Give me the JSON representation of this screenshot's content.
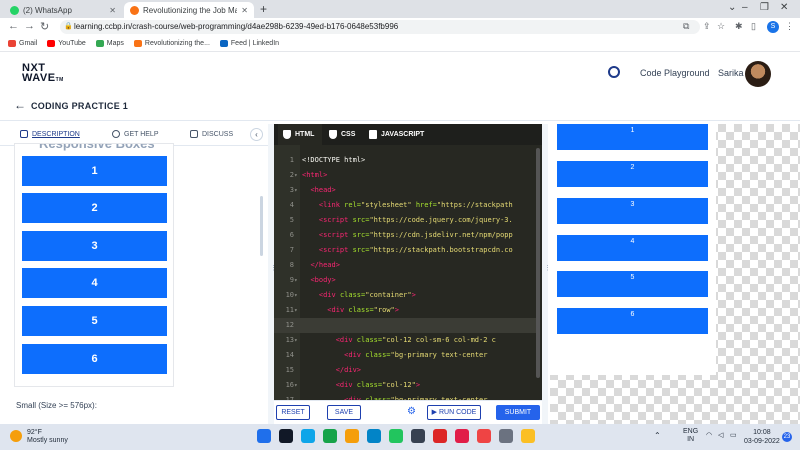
{
  "browser": {
    "tabs": [
      {
        "title": "(2) WhatsApp",
        "favicon_color": "#25d366"
      },
      {
        "title": "Revolutionizing the Job Market |",
        "favicon_color": "#f97316"
      }
    ],
    "url": "learning.ccbp.in/crash-course/web-programming/d4ae298b-6239-49ed-b176-0648e53fb996",
    "profile_initial": "S",
    "bookmarks": [
      {
        "label": "Gmail",
        "color": "#ea4335"
      },
      {
        "label": "YouTube",
        "color": "#ff0000"
      },
      {
        "label": "Maps",
        "color": "#34a853"
      },
      {
        "label": "Revolutionizing the...",
        "color": "#f97316"
      },
      {
        "label": "Feed | LinkedIn",
        "color": "#0a66c2"
      }
    ]
  },
  "app": {
    "logo_line1": "NXT",
    "logo_line2": "WAVE",
    "logo_tm": "TM",
    "code_playground": "Code Playground",
    "user_name": "Sarika",
    "page_title": "CODING PRACTICE 1"
  },
  "left": {
    "tabs": [
      "DESCRIPTION",
      "GET HELP",
      "DISCUSS"
    ],
    "collapse": "‹",
    "cut_heading": "Responsive Boxes",
    "boxes": [
      "1",
      "2",
      "3",
      "4",
      "5",
      "6"
    ],
    "size_note": "Small (Size >= 576px):"
  },
  "editor": {
    "tabs": [
      "HTML",
      "CSS",
      "JAVASCRIPT"
    ],
    "lines": [
      {
        "n": "1",
        "fold": "",
        "indent": "",
        "segs": [
          [
            "code",
            "<!DOCTYPE html>"
          ]
        ]
      },
      {
        "n": "2",
        "fold": "▾",
        "indent": "",
        "segs": [
          [
            "tag",
            "<html>"
          ]
        ]
      },
      {
        "n": "3",
        "fold": "▾",
        "indent": "  ",
        "segs": [
          [
            "tag",
            "<head>"
          ]
        ]
      },
      {
        "n": "4",
        "fold": "",
        "indent": "    ",
        "segs": [
          [
            "tag",
            "<link "
          ],
          [
            "attr",
            "rel="
          ],
          [
            "str",
            "\"stylesheet\" "
          ],
          [
            "attr",
            "href="
          ],
          [
            "str",
            "\"https://stackpath"
          ]
        ]
      },
      {
        "n": "5",
        "fold": "",
        "indent": "    ",
        "segs": [
          [
            "tag",
            "<script "
          ],
          [
            "attr",
            "src="
          ],
          [
            "str",
            "\"https://code.jquery.com/jquery-3."
          ]
        ]
      },
      {
        "n": "6",
        "fold": "",
        "indent": "    ",
        "segs": [
          [
            "tag",
            "<script "
          ],
          [
            "attr",
            "src="
          ],
          [
            "str",
            "\"https://cdn.jsdelivr.net/npm/popp"
          ]
        ]
      },
      {
        "n": "7",
        "fold": "",
        "indent": "    ",
        "segs": [
          [
            "tag",
            "<script "
          ],
          [
            "attr",
            "src="
          ],
          [
            "str",
            "\"https://stackpath.bootstrapcdn.co"
          ]
        ]
      },
      {
        "n": "8",
        "fold": "",
        "indent": "  ",
        "segs": [
          [
            "tag",
            "</head>"
          ]
        ]
      },
      {
        "n": "9",
        "fold": "▾",
        "indent": "  ",
        "segs": [
          [
            "tag",
            "<body>"
          ]
        ]
      },
      {
        "n": "10",
        "fold": "▾",
        "indent": "    ",
        "segs": [
          [
            "tag",
            "<div "
          ],
          [
            "attr",
            "class="
          ],
          [
            "str",
            "\"container\""
          ],
          [
            "tag",
            ">"
          ]
        ]
      },
      {
        "n": "11",
        "fold": "▾",
        "indent": "      ",
        "segs": [
          [
            "tag",
            "<div "
          ],
          [
            "attr",
            "class="
          ],
          [
            "str",
            "\"row\""
          ],
          [
            "tag",
            ">"
          ]
        ]
      },
      {
        "n": "12",
        "fold": "",
        "indent": "",
        "segs": [
          [
            "code",
            ""
          ]
        ]
      },
      {
        "n": "13",
        "fold": "▾",
        "indent": "        ",
        "segs": [
          [
            "tag",
            "<div "
          ],
          [
            "attr",
            "class="
          ],
          [
            "str",
            "\"col-12 col-sm-6 col-md-2 c"
          ]
        ]
      },
      {
        "n": "14",
        "fold": "",
        "indent": "          ",
        "segs": [
          [
            "tag",
            "<div "
          ],
          [
            "attr",
            "class="
          ],
          [
            "str",
            "\"bg-primary text-center"
          ]
        ]
      },
      {
        "n": "15",
        "fold": "",
        "indent": "        ",
        "segs": [
          [
            "tag",
            "</div>"
          ]
        ]
      },
      {
        "n": "16",
        "fold": "▾",
        "indent": "        ",
        "segs": [
          [
            "tag",
            "<div "
          ],
          [
            "attr",
            "class="
          ],
          [
            "str",
            "\"col-12\""
          ],
          [
            "tag",
            ">"
          ]
        ]
      },
      {
        "n": "17",
        "fold": "",
        "indent": "          ",
        "segs": [
          [
            "tag",
            "<div "
          ],
          [
            "attr",
            "class="
          ],
          [
            "str",
            "\"bg-primary text-center"
          ]
        ]
      }
    ],
    "buttons": {
      "reset": "RESET",
      "save": "SAVE",
      "run": "▶ RUN CODE",
      "submit": "SUBMIT"
    }
  },
  "output": {
    "boxes": [
      "1",
      "2",
      "3",
      "4",
      "5",
      "6"
    ]
  },
  "taskbar": {
    "temperature": "92°F",
    "weather": "Mostly sunny",
    "lang_line1": "ENG",
    "lang_line2": "IN",
    "time": "10:08",
    "date": "03-09-2022",
    "notifications": "23",
    "app_colors": [
      "#1f6feb",
      "#111827",
      "#0ea5e9",
      "#16a34a",
      "#f59e0b",
      "#0284c7",
      "#22c55e",
      "#374151",
      "#dc2626",
      "#e11d48",
      "#ef4444",
      "#6b7280",
      "#fbbf24"
    ]
  },
  "colors": {
    "primary_blue": "#0d6efd",
    "editor_bg": "#272822",
    "button_blue": "#2563eb"
  }
}
